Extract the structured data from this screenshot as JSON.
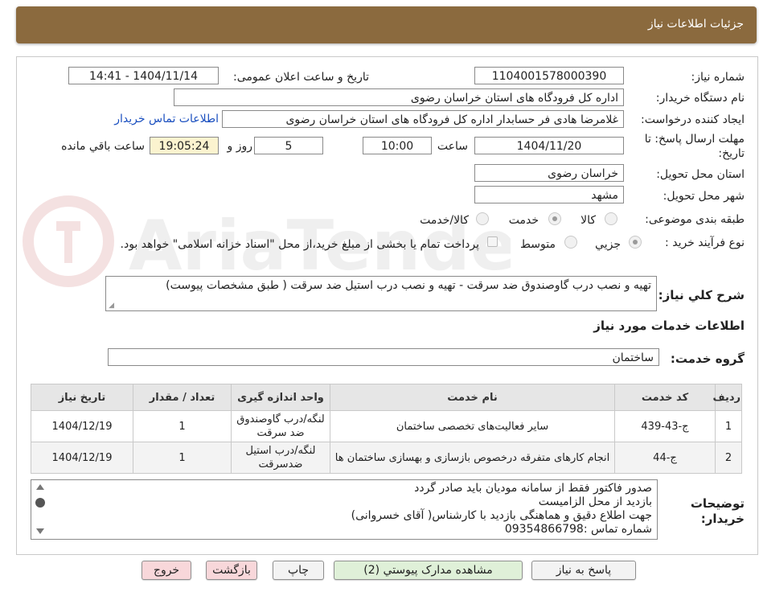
{
  "header": {
    "title": "جزئیات اطلاعات نیاز"
  },
  "watermark": {
    "text": "AriaTender.neT"
  },
  "form": {
    "need_number": {
      "label": "شماره نیاز:",
      "value": "1104001578000390"
    },
    "announce": {
      "label": "تاریخ و ساعت اعلان عمومی:",
      "value": "1404/11/14 - 14:41"
    },
    "buyer_org": {
      "label": "نام دستگاه خریدار:",
      "value": "اداره کل فرودگاه های استان خراسان رضوی"
    },
    "requester": {
      "label": "ایجاد کننده درخواست:",
      "value": "غلامرضا هادی فر حسابدار اداره کل فرودگاه های استان خراسان رضوی",
      "contact_link": "اطلاعات تماس خریدار"
    },
    "deadline": {
      "label_line1": "مهلت ارسال پاسخ: تا",
      "label_line2": "تاریخ:",
      "date": "1404/11/20",
      "time_label": "ساعت",
      "time": "10:00",
      "days": "5",
      "days_label": "روز و",
      "remaining": "19:05:24",
      "remaining_label": "ساعت باقي مانده"
    },
    "province": {
      "label": "استان محل تحویل:",
      "value": "خراسان رضوی"
    },
    "city": {
      "label": "شهر محل تحویل:",
      "value": "مشهد"
    },
    "category": {
      "label": "طبقه بندی موضوعی:",
      "options": [
        "کالا",
        "خدمت",
        "کالا/خدمت"
      ],
      "selected": "خدمت"
    },
    "process": {
      "label": "نوع فرآیند خرید :",
      "options": [
        "جزیي",
        "متوسط"
      ],
      "selected": "جزیي",
      "payment_note": "پرداخت تمام یا بخشی از مبلغ خرید،از محل \"اسناد خزانه اسلامی\" خواهد بود."
    },
    "summary": {
      "label": "شرح کلي نياز:",
      "value": "تهیه و نصب درب گاوصندوق ضد سرقت - تهیه و نصب درب استیل ضد سرقت ( طبق مشخصات پیوست)"
    },
    "services_title": "اطلاعات خدمات مورد نیاز",
    "service_group": {
      "label": "گروه خدمت:",
      "value": "ساختمان"
    }
  },
  "table": {
    "headers": [
      "ردیف",
      "کد خدمت",
      "نام خدمت",
      "واحد اندازه گیری",
      "تعداد / مقدار",
      "تاریخ نیاز"
    ],
    "rows": [
      {
        "index": "1",
        "code": "ج-43-439",
        "name": "سایر فعالیت‌های تخصصی ساختمان",
        "unit": "لنگه/درب گاوصندوق ضد سرقت",
        "qty": "1",
        "date": "1404/12/19"
      },
      {
        "index": "2",
        "code": "ج-44",
        "name": "انجام کارهای متفرقه درخصوص بازسازی و بهسازی ساختمان ها",
        "unit": "لنگه/درب استیل ضدسرقت",
        "qty": "1",
        "date": "1404/12/19"
      }
    ]
  },
  "notes": {
    "label_line1": "توضیحات",
    "label_line2": "خریدار:",
    "lines": [
      "صدور فاکتور فقط از سامانه مودیان باید صادر گردد",
      "بازدید از محل الزامیست",
      "جهت اطلاع دقیق و هماهنگی بازدید با کارشناس( آقای خسروانی)",
      "شماره تماس :09354866798"
    ]
  },
  "buttons": {
    "reply": "پاسخ به نیاز",
    "attachments": "مشاهده مدارک پیوستي (2)",
    "print": "چاپ",
    "back": "بازگشت",
    "exit": "خروج"
  },
  "colors": {
    "header_bg": "#8b6a3e",
    "link": "#1a4fbf",
    "timer_bg": "#fbf3cf",
    "green_btn": "#dff0d8",
    "pink_btn": "#f8d7da"
  }
}
